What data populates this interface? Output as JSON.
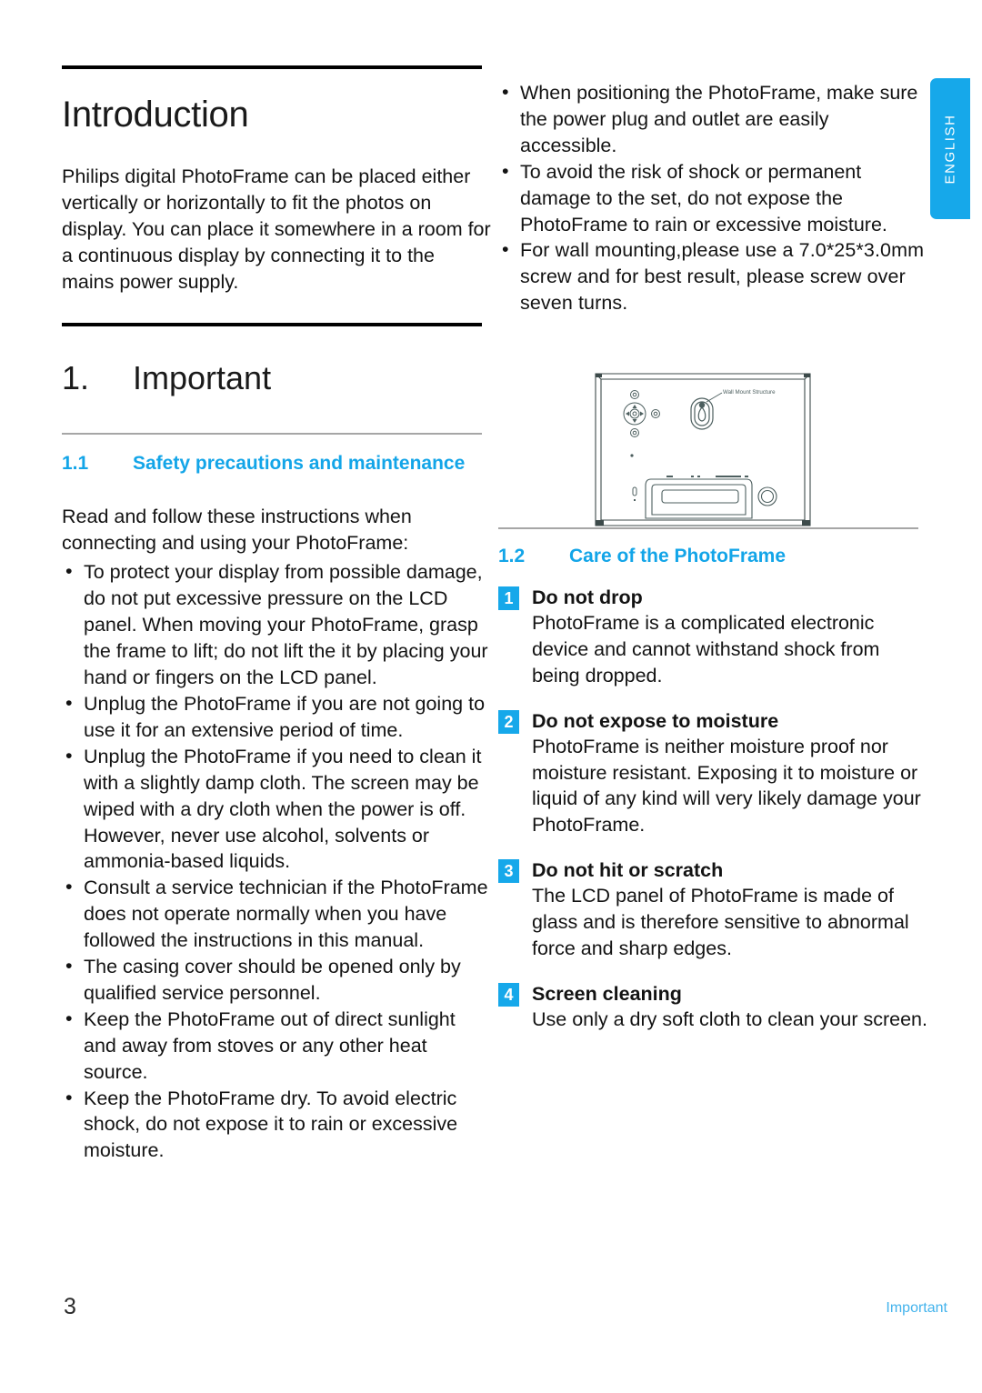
{
  "document": {
    "language_tab": "ENGLISH",
    "accent_color": "#16A8EA",
    "footer": {
      "page_number": "3",
      "section_label": "Important"
    }
  },
  "left_column": {
    "intro": {
      "title": "Introduction",
      "body": "Philips digital PhotoFrame can be placed either vertically or horizontally to fit the photos on display. You can place it somewhere in a room for a continuous display by connecting it to the mains power supply."
    },
    "chapter": {
      "number": "1.",
      "title": "Important"
    },
    "section_1_1": {
      "number": "1.1",
      "title": "Safety precautions and maintenance",
      "intro": "Read and follow these instructions when connecting and using your PhotoFrame:",
      "bullets": [
        "To protect your display from possible damage, do not put excessive pressure on the LCD panel. When moving your PhotoFrame, grasp the frame to lift; do not lift the it by placing your hand or fingers on the LCD panel.",
        "Unplug the PhotoFrame if you are not going to use it for an extensive period of time.",
        "Unplug the PhotoFrame if you need to clean it with a slightly damp cloth. The screen may be wiped with a dry cloth when the power is off. However, never use alcohol, solvents or ammonia-based liquids.",
        "Consult a service technician if the PhotoFrame does not operate normally when you have followed the instructions in this manual.",
        "The casing cover should be opened only by qualified service personnel.",
        "Keep the PhotoFrame out of direct sunlight and away from stoves or any other heat source.",
        "Keep the PhotoFrame dry. To avoid electric shock, do not expose it to rain or excessive moisture."
      ]
    }
  },
  "right_column": {
    "top_bullets": [
      "When positioning the PhotoFrame, make sure the power plug and outlet are easily accessible.",
      "To avoid the risk of shock or permanent damage to the set, do not expose the PhotoFrame to rain or excessive moisture.",
      "For wall mounting,please use a 7.0*25*3.0mm screw and for best result, please screw over seven turns."
    ],
    "figure": {
      "caption_label": "Wall Mount Structure",
      "alt": "Rear view line drawing of the PhotoFrame showing control buttons, wall mount keyhole and stand"
    },
    "section_1_2": {
      "number": "1.2",
      "title": "Care of the PhotoFrame",
      "items": [
        {
          "badge": "1",
          "title": "Do not drop",
          "body": "PhotoFrame is a complicated electronic device and cannot withstand shock from being dropped."
        },
        {
          "badge": "2",
          "title": "Do not expose to moisture",
          "body": "PhotoFrame is neither moisture proof nor moisture resistant. Exposing it to moisture or liquid of any kind will very likely damage your PhotoFrame."
        },
        {
          "badge": "3",
          "title": "Do not hit or scratch",
          "body": "The LCD panel of PhotoFrame is made of glass and is therefore sensitive to abnormal force and sharp edges."
        },
        {
          "badge": "4",
          "title": "Screen cleaning",
          "body": "Use only a dry soft cloth to clean your screen."
        }
      ]
    }
  }
}
